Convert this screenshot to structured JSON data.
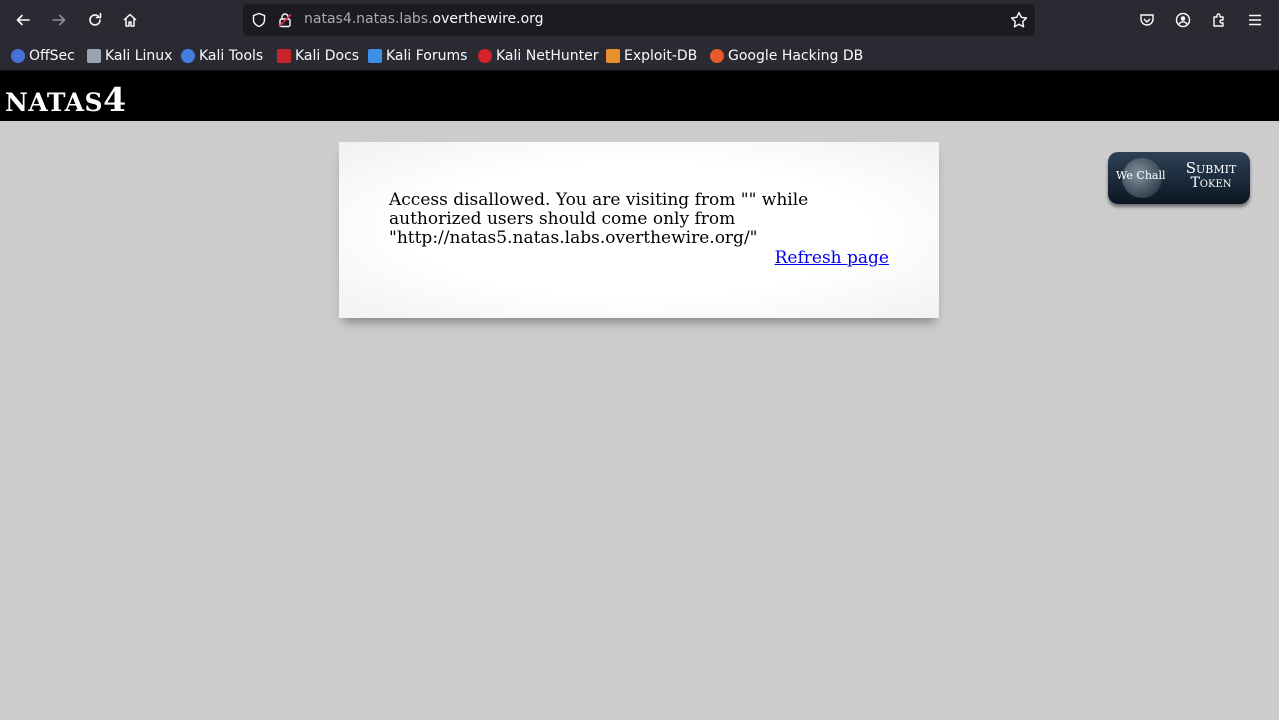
{
  "browser": {
    "url_prefix": "natas4.natas.labs.",
    "url_domain": "overthewire.org"
  },
  "bookmarks": [
    {
      "label": "OffSec",
      "icon": "offsec-icon",
      "color": "#4a6fd6"
    },
    {
      "label": "Kali Linux",
      "icon": "kali-dragon-icon",
      "color": "#9aa4b1"
    },
    {
      "label": "Kali Tools",
      "icon": "kali-tools-icon",
      "color": "#3f7fe0"
    },
    {
      "label": "Kali Docs",
      "icon": "kali-docs-icon",
      "color": "#c8242b"
    },
    {
      "label": "Kali Forums",
      "icon": "kali-forums-icon",
      "color": "#3d8fe8"
    },
    {
      "label": "Kali NetHunter",
      "icon": "nethunter-icon",
      "color": "#d2232a"
    },
    {
      "label": "Exploit-DB",
      "icon": "exploit-db-icon",
      "color": "#e8902c"
    },
    {
      "label": "Google Hacking DB",
      "icon": "ghdb-icon",
      "color": "#e55a26"
    }
  ],
  "site": {
    "title_prefix": "NATAS",
    "title_number": "4"
  },
  "content": {
    "message": "Access disallowed. You are visiting from \"\" while authorized users should come only from \"http://natas5.natas.labs.overthewire.org/\"",
    "refresh_label": "Refresh page"
  },
  "token_button": {
    "logo_text": "We Chall",
    "line1": "Submit",
    "line2": "Token"
  }
}
